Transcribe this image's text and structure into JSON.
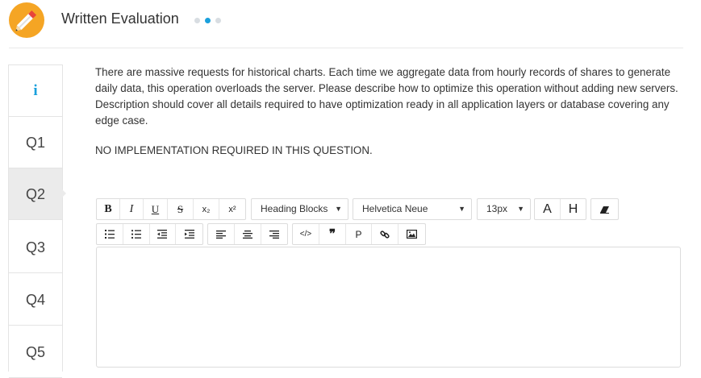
{
  "header": {
    "title": "Written Evaluation",
    "steps": 3,
    "active_step": 2,
    "accent": "#1aa0dc",
    "logo_color": "#f5a524"
  },
  "sidebar": {
    "items": [
      {
        "label": "i",
        "icon": "info-icon"
      },
      {
        "label": "Q1"
      },
      {
        "label": "Q2",
        "active": true
      },
      {
        "label": "Q3"
      },
      {
        "label": "Q4"
      },
      {
        "label": "Q5"
      }
    ]
  },
  "question": {
    "text": "There are massive requests for historical charts. Each time we aggregate data from hourly records of shares to generate daily data, this operation overloads the server. Please describe how to optimize this operation without adding new servers. Description should cover all details required to have optimization ready in all application layers or database covering any edge case.",
    "note": "NO IMPLEMENTATION REQUIRED IN THIS QUESTION."
  },
  "toolbar": {
    "bold": "B",
    "italic": "I",
    "underline": "U",
    "strike": "S",
    "subscript": "x₂",
    "superscript": "x²",
    "heading_select": "Heading Blocks",
    "font_select": "Helvetica Neue",
    "size_select": "13px",
    "font_color": "A",
    "highlight": "H",
    "paragraph": "P"
  },
  "editor": {
    "value": ""
  }
}
